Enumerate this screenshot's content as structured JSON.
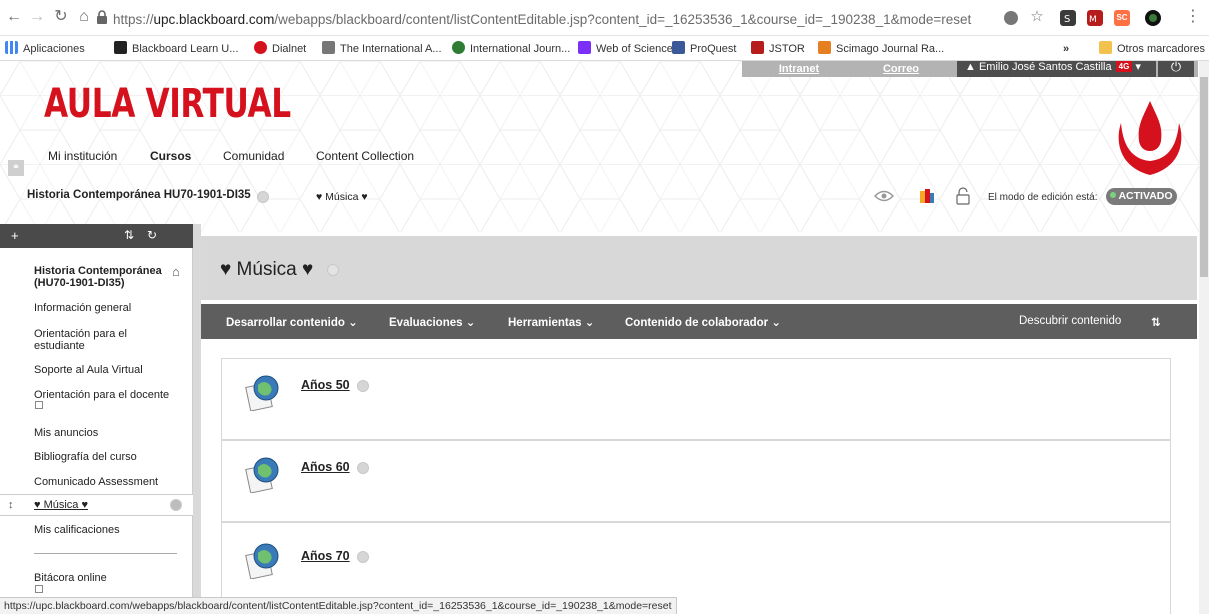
{
  "browser": {
    "url_prefix": "https://",
    "url_host": "upc.blackboard.com",
    "url_path": "/webapps/blackboard/content/listContentEditable.jsp?content_id=_16253536_1&course_id=_190238_1&mode=reset",
    "extensions": [
      "SC"
    ],
    "bookmarks": [
      {
        "label": "Aplicaciones",
        "color": "#4285f4"
      },
      {
        "label": "Blackboard Learn U...",
        "color": "#222222"
      },
      {
        "label": "Dialnet",
        "color": "#d5111d"
      },
      {
        "label": "The International A...",
        "color": "#555555"
      },
      {
        "label": "International Journ...",
        "color": "#2e7d32"
      },
      {
        "label": "Web of Science",
        "color": "#7b2ff7"
      },
      {
        "label": "ProQuest",
        "color": "#3b5998"
      },
      {
        "label": "JSTOR",
        "color": "#b71c1c"
      },
      {
        "label": "Scimago Journal Ra...",
        "color": "#e67e22"
      }
    ],
    "other_bookmarks": "Otros marcadores",
    "overflow": "»",
    "status_url": "https://upc.blackboard.com/webapps/blackboard/content/listContentEditable.jsp?content_id=_16253536_1&course_id=_190238_1&mode=reset"
  },
  "header": {
    "brand": "AULA VIRTUAL",
    "intranet": "Intranet",
    "correo": "Correo",
    "user": "Emilio José Santos Castilla",
    "badge": "4G",
    "nav": [
      "Mi institución",
      "Cursos",
      "Comunidad",
      "Content Collection"
    ]
  },
  "coursebar": {
    "course": "Historia Contemporánea HU70-1901-DI35",
    "breadcrumb": "♥ Música ♥",
    "edit_mode_label": "El modo de edición está:",
    "edit_mode_value": "ACTIVADO"
  },
  "sidebar": {
    "course_title": "Historia Contemporánea (HU70-1901-DI35)",
    "items": [
      "Información general",
      "Orientación para el estudiante",
      "Soporte al Aula Virtual",
      "Orientación para el docente",
      "Mis anuncios",
      "Bibliografía del curso",
      "Comunicado Assessment",
      "♥ Música ♥",
      "Mis calificaciones",
      "Bitácora online"
    ]
  },
  "content": {
    "title": "♥ Música ♥",
    "actions": [
      "Desarrollar contenido",
      "Evaluaciones",
      "Herramientas",
      "Contenido de colaborador"
    ],
    "discover": "Descubrir contenido",
    "items": [
      "Años 50",
      "Años 60",
      "Años 70"
    ]
  },
  "colors": {
    "brand_red": "#d5111d",
    "action_bar": "#5e5e5e",
    "page_head": "#d8d8d8"
  }
}
